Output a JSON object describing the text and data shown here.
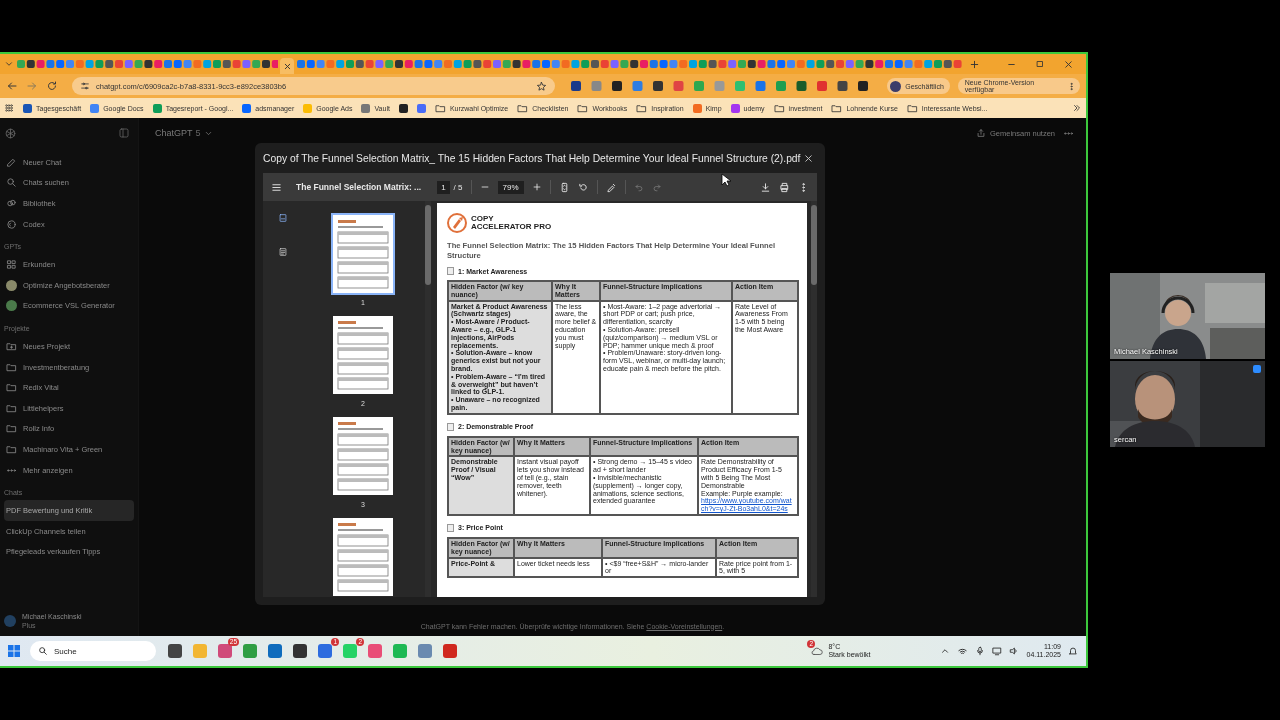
{
  "browser": {
    "address": "chatgpt.com/c/6909ca2c-b7a8-8331-9cc3-e892ce3803b6",
    "profile": "Geschäftlich",
    "update": "Neue Chrome-Version verfügbar",
    "bookmarks": [
      {
        "kind": "site",
        "color": "#1a55b5",
        "label": "Tagesgeschäft"
      },
      {
        "kind": "site",
        "color": "#4285f4",
        "label": "Google Docs"
      },
      {
        "kind": "site",
        "color": "#0f9d58",
        "label": "Tagesreport - Googl..."
      },
      {
        "kind": "site",
        "color": "#0866ff",
        "label": "adsmanager"
      },
      {
        "kind": "site",
        "color": "#fbbc04",
        "label": "Google Ads"
      },
      {
        "kind": "site",
        "color": "#777777",
        "label": "Vault"
      },
      {
        "kind": "site",
        "color": "#222222"
      },
      {
        "kind": "site",
        "color": "#4a6cf7"
      },
      {
        "kind": "folder",
        "label": "Kurzwahl Optimize"
      },
      {
        "kind": "folder",
        "label": "Checklisten"
      },
      {
        "kind": "folder",
        "label": "Workbooks"
      },
      {
        "kind": "folder",
        "label": "Inspiration"
      },
      {
        "kind": "site",
        "color": "#f26b21",
        "label": "Kimp"
      },
      {
        "kind": "site",
        "color": "#a435f0",
        "label": "udemy"
      },
      {
        "kind": "folder",
        "label": "investment"
      },
      {
        "kind": "folder",
        "label": "Lohnende Kurse"
      },
      {
        "kind": "folder",
        "label": "Interessante Websi..."
      }
    ]
  },
  "chatgpt": {
    "model": "ChatGPT",
    "version": "5",
    "share": "Gemeinsam nutzen",
    "sidebar": {
      "top": [
        {
          "kind": "pen",
          "label": "Neuer Chat"
        },
        {
          "kind": "search",
          "label": "Chats suchen"
        },
        {
          "kind": "library",
          "label": "Bibliothek"
        },
        {
          "kind": "codex",
          "label": "Codex"
        }
      ],
      "gpts_heading": "GPTs",
      "gpts": [
        {
          "kind": "grid",
          "label": "Erkunden"
        },
        {
          "kind": "avatar",
          "color": "#8a8a6a",
          "label": "Optimize Angebotsberater"
        },
        {
          "kind": "avatar",
          "color": "#4a7a4a",
          "label": "Ecommerce VSL Generator"
        }
      ],
      "projects_heading": "Projekte",
      "projects": [
        {
          "kind": "newfolder",
          "label": "Neues Projekt"
        },
        {
          "kind": "folder",
          "label": "Investmentberatung"
        },
        {
          "kind": "folder",
          "label": "Redix Vital"
        },
        {
          "kind": "folder",
          "label": "Littlehelpers"
        },
        {
          "kind": "folder",
          "label": "Rollz Info"
        },
        {
          "kind": "folder",
          "label": "Machinaro Vita + Green"
        },
        {
          "kind": "dots",
          "label": "Mehr anzeigen"
        }
      ],
      "chats_heading": "Chats",
      "chats": [
        {
          "label": "PDF Bewertung und Kritik",
          "selected": true
        },
        {
          "label": "ClickUp Channels teilen",
          "selected": false
        },
        {
          "label": "Pflegeleads verkaufen Tipps",
          "selected": false
        }
      ],
      "user": {
        "name": "Michael Kaschinski",
        "plan": "Plus"
      }
    },
    "disclaimer": "ChatGPT kann Fehler machen. Überprüfe wichtige Informationen. Siehe",
    "disclaimer_link": "Cookie-Voreinstellungen",
    "disclaimer_end": "."
  },
  "pdf": {
    "file_name": "Copy of The Funnel Selection Matrix_ The 15 Hidden Factors That Help Determine Your Ideal Funnel Structure (2).pdf",
    "doc_title": "The Funnel Selection Matrix: ...",
    "page": "1",
    "page_total": "/ 5",
    "zoom": "79%",
    "thumbnails": [
      {
        "label": "1",
        "selected": true
      },
      {
        "label": "2",
        "selected": false
      },
      {
        "label": "3",
        "selected": false
      },
      {
        "selected": false
      }
    ],
    "logo": [
      "COPY",
      "ACCELERATOR PRO"
    ],
    "heading": "The Funnel Selection Matrix: The 15 Hidden Factors That Help Determine Your Ideal Funnel Structure",
    "sections": [
      {
        "title": "1:  Market Awareness",
        "columns": [
          "Hidden Factor (w/ key nuance)",
          "Why It Matters",
          "Funnel-Structure Implications",
          "Action Item"
        ],
        "row": [
          {
            "lines": [
              "Market & Product Awareness (Schwartz stages)",
              "• Most-Aware / Product-Aware – e.g., GLP-1 injections, AirPods replacements.",
              "• Solution-Aware – know generics exist but not your brand.",
              "• Problem-Aware – “I’m tired & overweight” but haven’t linked to GLP-1.",
              "• Unaware – no recognized pain."
            ]
          },
          {
            "lines": [
              "The less aware, the more belief & education you must supply"
            ]
          },
          {
            "lines": [
              "• Most-Aware: 1–2 page advertorial → short PDP or cart; push price, differentiation, scarcity",
              "• Solution-Aware: presell (quiz/comparison) → medium VSL or PDP; hammer unique mech & proof",
              "• Problem/Unaware: story-driven long-form VSL, webinar, or multi-day launch; educate pain & mech before the pitch."
            ]
          },
          {
            "lines": [
              "Rate Level of Awareness From 1-5 with 5 being the Most Aware"
            ]
          }
        ]
      },
      {
        "title": "2: Demonstrable Proof",
        "columns": [
          "Hidden Factor (w/ key nuance)",
          "Why It Matters",
          "Funnel-Structure Implications",
          "Action Item"
        ],
        "row": [
          {
            "lines": [
              "Demonstrable Proof / Visual “Wow”"
            ]
          },
          {
            "lines": [
              "Instant visual payoff lets you show instead of tell (e.g., stain remover, teeth whitener)."
            ]
          },
          {
            "lines": [
              "• Strong demo → 15–45 s video ad + short lander",
              "• Invisible/mechanistic (supplement) → longer copy, animations, science sections, extended guarantee"
            ]
          },
          {
            "lines": [
              "Rate Demonstrability of Product Efficacy From 1-5 with 5 Being The Most Demonstrable",
              "Example: Purple example:"
            ],
            "link": "https://www.youtube.com/watch?v=yJ-Zt-Bo3ahL0&t=24s"
          }
        ]
      },
      {
        "title": "3: Price Point",
        "columns": [
          "Hidden Factor (w/ key nuance)",
          "Why It Matters",
          "Funnel-Structure Implications",
          "Action Item"
        ],
        "row": [
          {
            "lines": [
              "Price-Point &"
            ]
          },
          {
            "lines": [
              "Lower ticket needs less"
            ]
          },
          {
            "lines": [
              "• <$9 “free+S&H” → micro-lander or"
            ]
          },
          {
            "lines": [
              "Rate price point from 1-5, with 5"
            ]
          }
        ]
      }
    ]
  },
  "taskbar": {
    "search": "Suche",
    "apps": [
      {
        "color": "#444444"
      },
      {
        "color": "#f2b632"
      },
      {
        "color": "#d04a7a",
        "badge": "25"
      },
      {
        "color": "#2f9e44"
      },
      {
        "color": "#0f6cbd"
      },
      {
        "color": "#333333"
      },
      {
        "color": "#2d6cdf",
        "badge": "1"
      },
      {
        "color": "#25d366",
        "badge": "2"
      },
      {
        "color": "#e94e77"
      },
      {
        "color": "#1db954"
      },
      {
        "color": "#6a8ab0"
      },
      {
        "color": "#d0281e"
      }
    ],
    "weather_badge": "2",
    "temperature": "8°C",
    "weather": "Stark bewölkt",
    "time": "11:09",
    "date": "04.11.2025"
  },
  "call": {
    "participants": [
      {
        "name": "Michael Kaschinski",
        "kind": "picture"
      },
      {
        "name": "sercan",
        "kind": "picture"
      }
    ]
  }
}
